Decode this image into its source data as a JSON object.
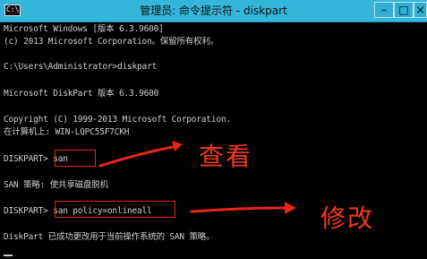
{
  "window": {
    "title": "管理员: 命令提示符 - diskpart",
    "icon_glyph": "C:\\",
    "buttons": {
      "minimize": "–",
      "maximize": "□",
      "close": "×"
    }
  },
  "console": {
    "lines": [
      "Microsoft Windows [版本 6.3.9600]",
      "(c) 2013 Microsoft Corporation。保留所有权利。",
      "",
      "C:\\Users\\Administrator>diskpart",
      "",
      "Microsoft DiskPart 版本 6.3.9600",
      "",
      "Copyright (C) 1999-2013 Microsoft Corporation.",
      "在计算机上: WIN-LQPC55F7CKH",
      "",
      "DISKPART> san",
      "",
      "SAN 策略: 使共享磁盘脱机",
      "",
      "DISKPART> san policy=onlineall",
      "",
      "DiskPart 已成功更改用于当前操作系统的 SAN 策略。"
    ]
  },
  "annotations": {
    "view_label": "查看",
    "modify_label": "修改",
    "color": "#f0391a"
  }
}
